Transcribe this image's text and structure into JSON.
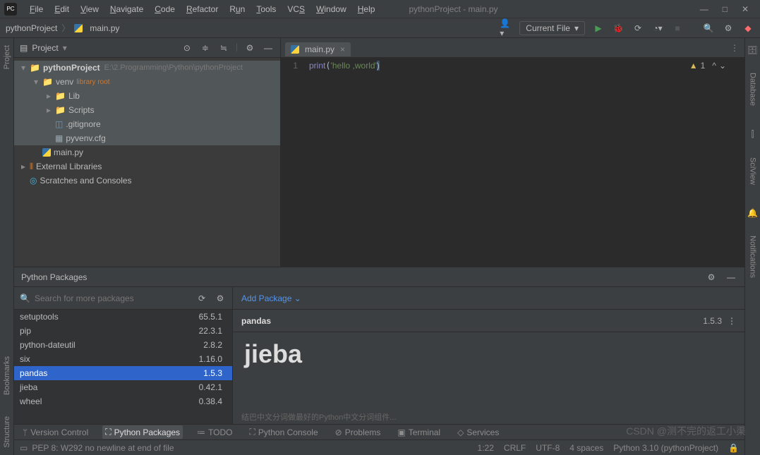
{
  "window": {
    "title": "pythonProject - main.py"
  },
  "menubar": [
    "File",
    "Edit",
    "View",
    "Navigate",
    "Code",
    "Refactor",
    "Run",
    "Tools",
    "VCS",
    "Window",
    "Help"
  ],
  "breadcrumb": {
    "project": "pythonProject",
    "file": "main.py"
  },
  "runconfig": {
    "label": "Current File"
  },
  "project_panel": {
    "title": "Project",
    "root": {
      "name": "pythonProject",
      "path": "E:\\2.Programming\\Python\\pythonProject"
    },
    "venv": {
      "name": "venv",
      "tag": "library root"
    },
    "lib": "Lib",
    "scripts": "Scripts",
    "gitignore": ".gitignore",
    "pyvenv": "pyvenv.cfg",
    "mainpy": "main.py",
    "external": "External Libraries",
    "scratches": "Scratches and Consoles"
  },
  "editor": {
    "tab": "main.py",
    "line_no": "1",
    "code_kw": "print",
    "code_str": "'hello ,world'",
    "warnings": "1"
  },
  "packages_panel": {
    "title": "Python Packages",
    "search_placeholder": "Search for more packages",
    "add_label": "Add Package",
    "list": [
      {
        "name": "setuptools",
        "ver": "65.5.1"
      },
      {
        "name": "pip",
        "ver": "22.3.1"
      },
      {
        "name": "python-dateutil",
        "ver": "2.8.2"
      },
      {
        "name": "six",
        "ver": "1.16.0"
      },
      {
        "name": "pandas",
        "ver": "1.5.3",
        "selected": true
      },
      {
        "name": "jieba",
        "ver": "0.42.1"
      },
      {
        "name": "wheel",
        "ver": "0.38.4"
      }
    ],
    "detail": {
      "name": "pandas",
      "version": "1.5.3",
      "headline": "jieba"
    }
  },
  "toolwindows": {
    "version_control": "Version Control",
    "python_packages": "Python Packages",
    "todo": "TODO",
    "python_console": "Python Console",
    "problems": "Problems",
    "terminal": "Terminal",
    "services": "Services"
  },
  "statusbar": {
    "msg": "PEP 8: W292 no newline at end of file",
    "pos": "1:22",
    "eol": "CRLF",
    "enc": "UTF-8",
    "indent": "4 spaces",
    "interp": "Python 3.10 (pythonProject)"
  },
  "right_gutter": [
    "Database",
    "SciView",
    "Notifications"
  ],
  "left_gutter": [
    "Project",
    "Bookmarks",
    "Structure"
  ],
  "watermark": "CSDN @测不完的返工小渠"
}
